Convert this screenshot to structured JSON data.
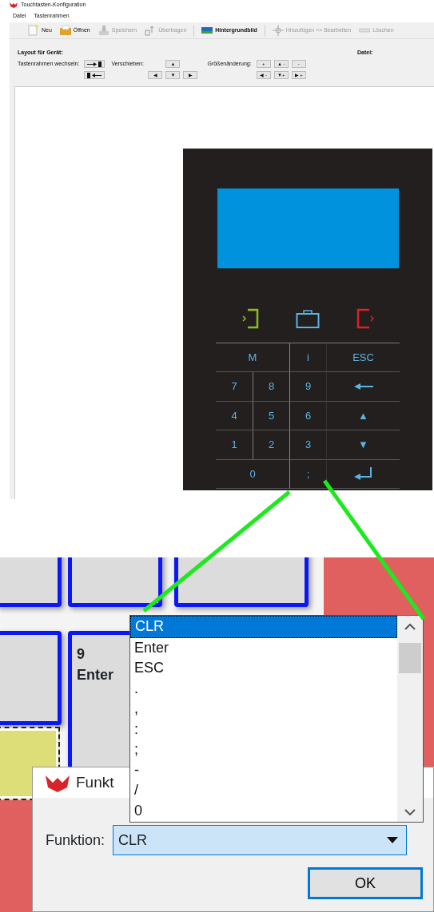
{
  "window": {
    "title": "Touchtasten-Konfiguration"
  },
  "menu": [
    {
      "label": "Datei"
    },
    {
      "label": "Tastenrahmen"
    }
  ],
  "toolbar": [
    {
      "label": "Neu",
      "disabled": false
    },
    {
      "label": "Öffnen",
      "disabled": false
    },
    {
      "label": "Speichern",
      "disabled": true
    },
    {
      "label": "Übertragen",
      "disabled": true
    },
    {
      "label": "Hintergrundbild",
      "disabled": false
    },
    {
      "label": "Hinzufügen => Bearbeiten",
      "disabled": true
    },
    {
      "label": "Löschen",
      "disabled": true
    }
  ],
  "layout_panel": {
    "device_label": "Layout für Gerät:",
    "file_label": "Datei:",
    "frame_switch_label": "Tastenrahmen wechseln:",
    "move_label": "Verschieben:",
    "move_buttons": [
      "▲",
      "◀",
      "▼",
      "▶"
    ],
    "resize_label": "Größenänderung:",
    "resize_buttons": [
      "+",
      "▲ -",
      "-",
      "◀ -",
      "▼+",
      "▶ +"
    ]
  },
  "device": {
    "keys": [
      {
        "kind": "wide",
        "label": "M"
      },
      {
        "kind": "key",
        "label": "i"
      },
      {
        "kind": "key",
        "label": "ESC"
      },
      {
        "kind": "key",
        "label": "7"
      },
      {
        "kind": "key",
        "label": "8"
      },
      {
        "kind": "key",
        "label": "9"
      },
      {
        "kind": "arrow"
      },
      {
        "kind": "key",
        "label": "4"
      },
      {
        "kind": "key",
        "label": "5"
      },
      {
        "kind": "key",
        "label": "6"
      },
      {
        "kind": "key",
        "label": "▲"
      },
      {
        "kind": "key",
        "label": "1"
      },
      {
        "kind": "key",
        "label": "2"
      },
      {
        "kind": "key",
        "label": "3"
      },
      {
        "kind": "key",
        "label": "▼"
      },
      {
        "kind": "wide",
        "label": "0"
      },
      {
        "kind": "key",
        "label": ";"
      },
      {
        "kind": "enter"
      }
    ]
  },
  "zoom": {
    "tile_text": [
      "9",
      "Enter"
    ],
    "dropdown": {
      "options": [
        {
          "label": "CLR",
          "selected": true
        },
        {
          "label": "Enter",
          "selected": false
        },
        {
          "label": "ESC",
          "selected": false
        },
        {
          "label": ".",
          "selected": false
        },
        {
          "label": ",",
          "selected": false
        },
        {
          "label": ":",
          "selected": false
        },
        {
          "label": ";",
          "selected": false
        },
        {
          "label": "-",
          "selected": false
        },
        {
          "label": "/",
          "selected": false
        },
        {
          "label": "0",
          "selected": false
        }
      ]
    },
    "dialog": {
      "title": "Funkt",
      "field_label": "Funktion:",
      "value": "CLR",
      "ok": "OK"
    }
  }
}
